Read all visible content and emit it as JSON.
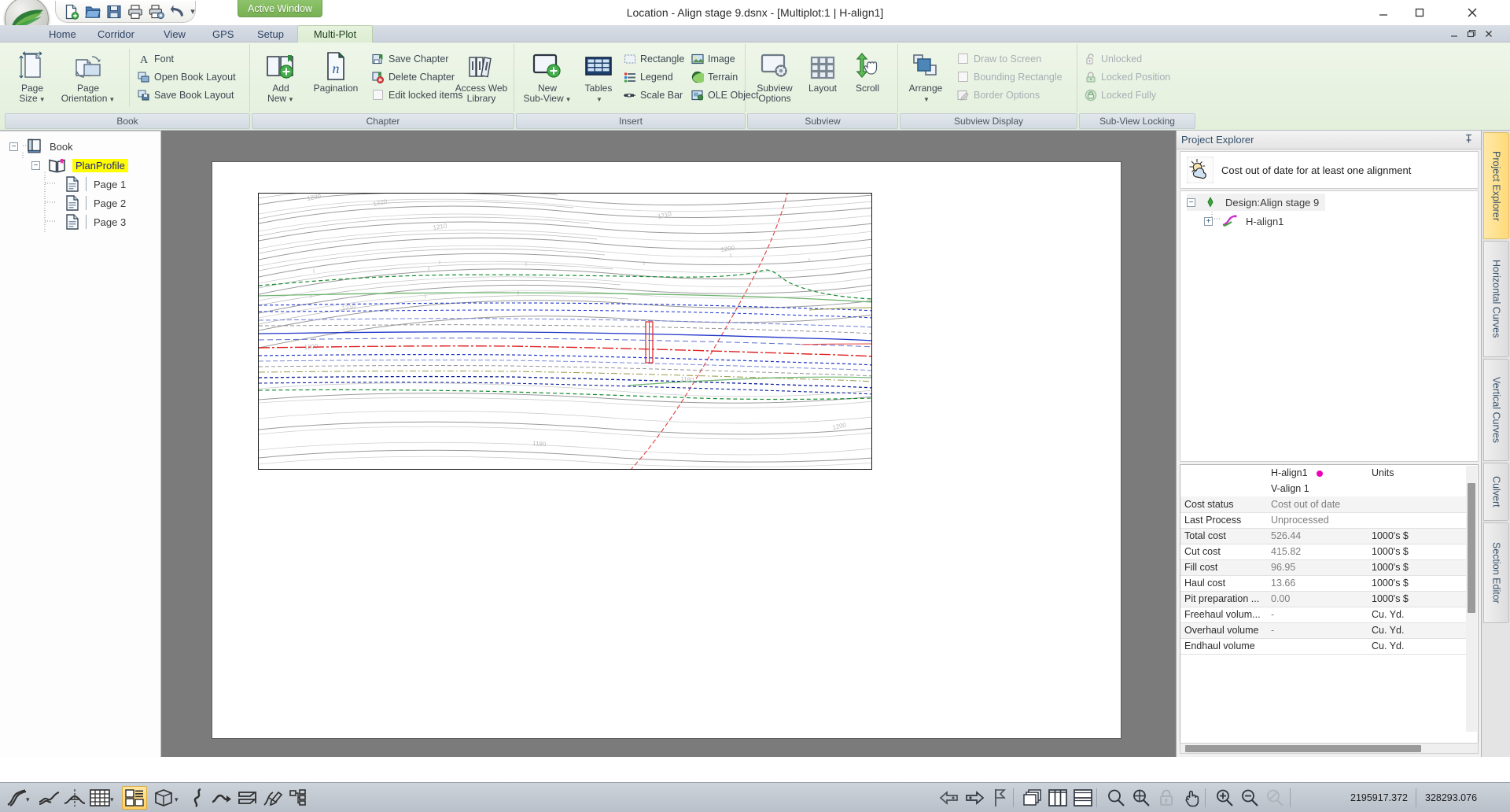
{
  "window": {
    "title": "Location - Align stage 9.dsnx - [Multiplot:1 | H-align1]",
    "active_window_tab": "Active Window",
    "minimize": "minimize-icon",
    "maximize": "maximize-icon",
    "close": "close-icon"
  },
  "quick_access": {
    "items": [
      {
        "name": "new-file-icon",
        "label": "New"
      },
      {
        "name": "open-folder-icon",
        "label": "Open"
      },
      {
        "name": "save-icon",
        "label": "Save"
      },
      {
        "name": "print-icon",
        "label": "Print"
      },
      {
        "name": "print-setup-icon",
        "label": "Print Setup"
      },
      {
        "name": "undo-icon",
        "label": "Undo"
      }
    ],
    "more": "customize-quick-access-icon"
  },
  "ribbon": {
    "tabs": [
      {
        "label": "Home",
        "active": false
      },
      {
        "label": "Corridor",
        "active": false
      },
      {
        "label": "View",
        "active": false
      },
      {
        "label": "GPS",
        "active": false
      },
      {
        "label": "Setup",
        "active": false
      },
      {
        "label": "Multi-Plot",
        "active": true
      }
    ],
    "groups": [
      {
        "label": "Book",
        "big_buttons": [
          {
            "label_line1": "Page",
            "label_line2": "Size",
            "icon": "page-size-icon",
            "dropdown": true
          },
          {
            "label_line1": "Page",
            "label_line2": "Orientation",
            "icon": "page-orientation-icon",
            "dropdown": true
          }
        ],
        "small_items": [
          {
            "label": "Font",
            "icon": "font-icon",
            "disabled": false
          },
          {
            "label": "Open Book Layout",
            "icon": "open-book-layout-icon",
            "disabled": false
          },
          {
            "label": "Save Book Layout",
            "icon": "save-book-layout-icon",
            "disabled": false
          }
        ]
      },
      {
        "label": "Chapter",
        "big_buttons": [
          {
            "label_line1": "Add",
            "label_line2": "New",
            "icon": "add-new-chapter-icon",
            "dropdown": true
          },
          {
            "label_line1": "Pagination",
            "label_line2": "",
            "icon": "pagination-icon",
            "dropdown": false
          },
          {
            "label_line1": "Access Web",
            "label_line2": "Library",
            "icon": "access-web-library-icon",
            "dropdown": false
          }
        ],
        "small_items": [
          {
            "label": "Save Chapter",
            "icon": "save-chapter-icon",
            "disabled": false
          },
          {
            "label": "Delete Chapter",
            "icon": "delete-chapter-icon",
            "disabled": false
          },
          {
            "label": "Edit locked items",
            "icon": "checkbox-icon",
            "disabled": false
          }
        ]
      },
      {
        "label": "Insert",
        "big_buttons": [
          {
            "label_line1": "New",
            "label_line2": "Sub-View",
            "icon": "new-subview-icon",
            "dropdown": true
          },
          {
            "label_line1": "Tables",
            "label_line2": "",
            "icon": "tables-icon",
            "dropdown": true
          }
        ],
        "small_items": [
          {
            "label": "Rectangle",
            "icon": "rectangle-icon",
            "dropdown": true,
            "disabled": false
          },
          {
            "label": "Legend",
            "icon": "legend-icon",
            "disabled": false
          },
          {
            "label": "Scale Bar",
            "icon": "scale-bar-icon",
            "disabled": false
          },
          {
            "label": "Image",
            "icon": "image-icon",
            "disabled": false
          },
          {
            "label": "Terrain",
            "icon": "terrain-icon",
            "disabled": false
          },
          {
            "label": "OLE Object",
            "icon": "ole-object-icon",
            "disabled": false
          }
        ]
      },
      {
        "label": "Subview",
        "big_buttons": [
          {
            "label_line1": "Subview",
            "label_line2": "Options",
            "icon": "subview-options-icon",
            "dropdown": false
          },
          {
            "label_line1": "Layout",
            "label_line2": "",
            "icon": "layout-grid-icon",
            "dropdown": false
          },
          {
            "label_line1": "Scroll",
            "label_line2": "",
            "icon": "scroll-hand-icon",
            "dropdown": false
          }
        ],
        "small_items": []
      },
      {
        "label": "Subview Display",
        "big_buttons": [
          {
            "label_line1": "Arrange",
            "label_line2": "",
            "icon": "arrange-icon",
            "dropdown": true
          }
        ],
        "small_items": [
          {
            "label": "Draw to Screen",
            "icon": "checkbox-icon",
            "disabled": true
          },
          {
            "label": "Bounding Rectangle",
            "icon": "checkbox-icon",
            "disabled": true
          },
          {
            "label": "Border Options",
            "icon": "border-options-icon",
            "disabled": true
          }
        ]
      },
      {
        "label": "Sub-View Locking",
        "big_buttons": [],
        "small_items": [
          {
            "label": "Unlocked",
            "icon": "unlocked-icon",
            "disabled": true
          },
          {
            "label": "Locked Position",
            "icon": "locked-position-icon",
            "disabled": true
          },
          {
            "label": "Locked Fully",
            "icon": "locked-fully-icon",
            "disabled": true
          }
        ]
      }
    ]
  },
  "book_tree": {
    "nodes": [
      {
        "label": "Book",
        "icon": "book-node-icon",
        "depth": 0,
        "expander": "-",
        "selected": false
      },
      {
        "label": "PlanProfile",
        "icon": "chapter-node-icon",
        "depth": 1,
        "expander": "-",
        "selected": true
      },
      {
        "label": "Page 1",
        "icon": "page-node-icon",
        "depth": 2,
        "expander": "",
        "selected": false
      },
      {
        "label": "Page 2",
        "icon": "page-node-icon",
        "depth": 2,
        "expander": "",
        "selected": false
      },
      {
        "label": "Page 3",
        "icon": "page-node-icon",
        "depth": 2,
        "expander": "",
        "selected": false
      }
    ]
  },
  "project_explorer": {
    "title": "Project Explorer",
    "pin": "pin-icon",
    "status_icon": "weather-cost-icon",
    "status_text": "Cost out of date for at least one alignment",
    "tree": [
      {
        "label": "Design:Align stage 9",
        "icon": "design-node-icon",
        "depth": 0,
        "expander": "-",
        "selected": true
      },
      {
        "label": "H-align1",
        "icon": "alignment-node-icon",
        "depth": 1,
        "expander": "+",
        "selected": false
      }
    ]
  },
  "results_table": {
    "header": {
      "col0": "",
      "col1": "H-align1",
      "col1_marker_color": "#ee00bb",
      "col2": "Units"
    },
    "subheader": {
      "col0": "",
      "col1": "V-align 1",
      "col2": ""
    },
    "rows": [
      {
        "label": "Cost status",
        "value": "Cost out of date",
        "units": ""
      },
      {
        "label": "Last Process",
        "value": "Unprocessed",
        "units": ""
      },
      {
        "label": "Total cost",
        "value": "526.44",
        "units": "1000's $"
      },
      {
        "label": "Cut cost",
        "value": "415.82",
        "units": "1000's $"
      },
      {
        "label": "Fill cost",
        "value": "96.95",
        "units": "1000's $"
      },
      {
        "label": "Haul cost",
        "value": "13.66",
        "units": "1000's $"
      },
      {
        "label": "Pit preparation ...",
        "value": "0.00",
        "units": "1000's $"
      },
      {
        "label": "Freehaul volum...",
        "value": "-",
        "units": "Cu. Yd."
      },
      {
        "label": "Overhaul volume",
        "value": "-",
        "units": "Cu. Yd."
      },
      {
        "label": "Endhaul volume",
        "value": "",
        "units": "Cu. Yd."
      }
    ]
  },
  "vertical_tabs": [
    {
      "label": "Project Explorer",
      "active": true
    },
    {
      "label": "Horizontal Curves",
      "active": false
    },
    {
      "label": "Vertical Curves",
      "active": false
    },
    {
      "label": "Culvert",
      "active": false
    },
    {
      "label": "Section Editor",
      "active": false
    }
  ],
  "bottom_toolbar": {
    "left_items": [
      {
        "name": "alignment-tool-icon",
        "selected": false,
        "caret": true
      },
      {
        "name": "profile-tool-icon",
        "selected": false,
        "caret": false
      },
      {
        "name": "cross-section-tool-icon",
        "selected": false,
        "caret": false
      },
      {
        "name": "table-tool-icon",
        "selected": false,
        "caret": true
      },
      {
        "name": "multiplot-tool-icon",
        "selected": true,
        "caret": false
      },
      {
        "name": "3d-view-tool-icon",
        "selected": false,
        "caret": true
      },
      {
        "name": "superelevation-tool-icon",
        "selected": false,
        "caret": false
      },
      {
        "name": "transition-tool-icon",
        "selected": false,
        "caret": false
      },
      {
        "name": "mass-haul-tool-icon",
        "selected": false,
        "caret": false
      },
      {
        "name": "design-edit-tool-icon",
        "selected": false,
        "caret": false
      },
      {
        "name": "hierarchy-tool-icon",
        "selected": false,
        "caret": false
      }
    ],
    "right_items": [
      {
        "name": "previous-icon"
      },
      {
        "name": "next-icon"
      },
      {
        "name": "flag-icon"
      },
      {
        "name": "cascade-windows-icon"
      },
      {
        "name": "tile-vertical-icon"
      },
      {
        "name": "tile-horizontal-icon"
      },
      {
        "name": "zoom-window-icon"
      },
      {
        "name": "zoom-extents-icon"
      },
      {
        "name": "zoom-lock-icon"
      },
      {
        "name": "pan-icon"
      },
      {
        "name": "zoom-in-icon"
      },
      {
        "name": "zoom-out-icon"
      },
      {
        "name": "zoom-previous-icon"
      }
    ],
    "coordinates": {
      "x": "2195917.372",
      "y": "328293.076"
    }
  },
  "plot": {
    "contour_labels": [
      "1230",
      "1220",
      "1210",
      "1210",
      "1200",
      "1180",
      "1200"
    ],
    "colors": {
      "contour_major": "#8a8a8a",
      "contour_minor": "#c8c8c8",
      "green_dashed": "#128a2c",
      "green_solid": "#6cb36c",
      "blue_dashed": "#1832c8",
      "blue_navy": "#0d1f96",
      "red_centerline": "#e02020",
      "red_alignment": "#e84040",
      "olive": "#9a9a4a"
    }
  }
}
